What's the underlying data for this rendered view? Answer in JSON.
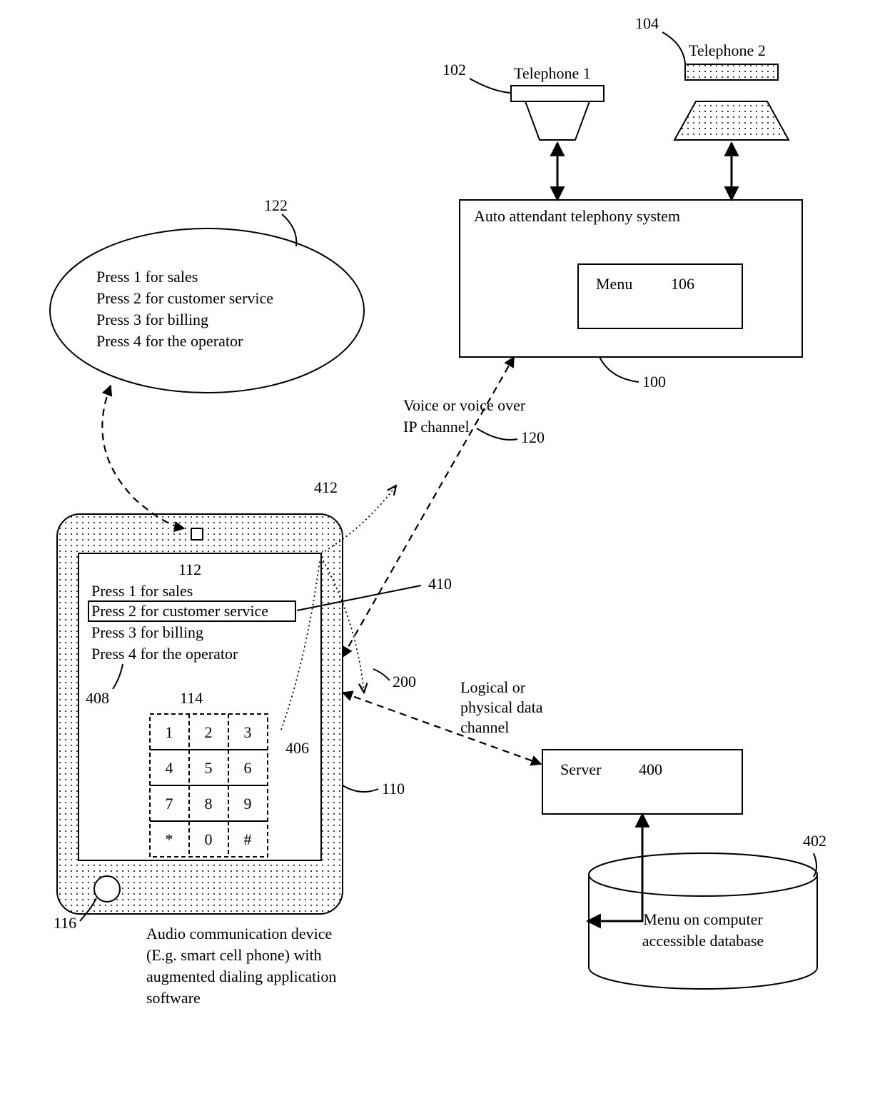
{
  "refs": {
    "r100": "100",
    "r102": "102",
    "r104": "104",
    "r106": "106",
    "r110": "110",
    "r112": "112",
    "r114": "114",
    "r116": "116",
    "r120": "120",
    "r122": "122",
    "r200": "200",
    "r400": "400",
    "r402": "402",
    "r406": "406",
    "r408": "408",
    "r410": "410",
    "r412": "412"
  },
  "labels": {
    "tel1": "Telephone 1",
    "tel2": "Telephone 2",
    "attendant": "Auto attendant telephony system",
    "menu_small": "Menu",
    "voice1": "Voice or voice over",
    "voice2": "IP channel",
    "data1": "Logical or",
    "data2": "physical data",
    "data3": "channel",
    "server": "Server",
    "db1": "Menu on computer",
    "db2": "accessible database",
    "device1": "Audio communication device",
    "device2": "(E.g. smart cell phone) with",
    "device3": "augmented dialing application",
    "device4": "software"
  },
  "menu": {
    "m1": "Press 1 for sales",
    "m2": "Press 2 for customer service",
    "m3": "Press 3 for billing",
    "m4": "Press 4 for the operator"
  },
  "keypad": {
    "k1": "1",
    "k2": "2",
    "k3": "3",
    "k4": "4",
    "k5": "5",
    "k6": "6",
    "k7": "7",
    "k8": "8",
    "k9": "9",
    "ks": "*",
    "k0": "0",
    "kh": "#"
  }
}
